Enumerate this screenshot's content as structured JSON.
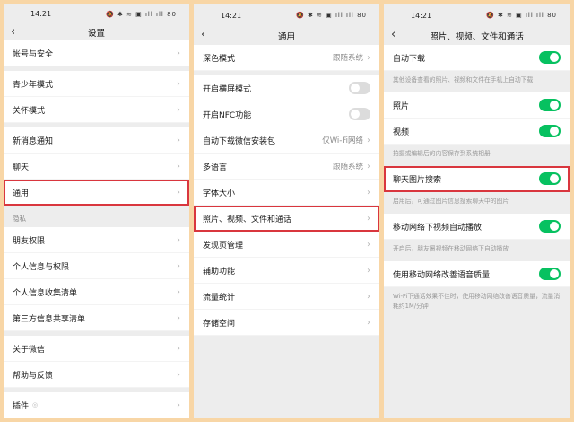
{
  "status_bar": {
    "time": "14:21",
    "icons": "🔕 ✱ ≋ ▣ ıll ıll 80"
  },
  "panels": [
    {
      "title": "设置",
      "items": [
        {
          "type": "row",
          "label": "帐号与安全",
          "chevron": true
        },
        {
          "type": "gap"
        },
        {
          "type": "row",
          "label": "青少年模式",
          "chevron": true
        },
        {
          "type": "row",
          "label": "关怀模式",
          "chevron": true
        },
        {
          "type": "gap"
        },
        {
          "type": "row",
          "label": "新消息通知",
          "chevron": true
        },
        {
          "type": "row",
          "label": "聊天",
          "chevron": true
        },
        {
          "type": "row",
          "label": "通用",
          "chevron": true,
          "highlight": true
        },
        {
          "type": "section",
          "label": "隐私"
        },
        {
          "type": "row",
          "label": "朋友权限",
          "chevron": true
        },
        {
          "type": "row",
          "label": "个人信息与权限",
          "chevron": true
        },
        {
          "type": "row",
          "label": "个人信息收集清单",
          "chevron": true
        },
        {
          "type": "row",
          "label": "第三方信息共享清单",
          "chevron": true
        },
        {
          "type": "gap"
        },
        {
          "type": "row",
          "label": "关于微信",
          "chevron": true
        },
        {
          "type": "row",
          "label": "帮助与反馈",
          "chevron": true
        },
        {
          "type": "gap"
        },
        {
          "type": "row",
          "label": "插件",
          "chevron": true,
          "icon": "plugin-pin-icon"
        }
      ]
    },
    {
      "title": "通用",
      "items": [
        {
          "type": "row",
          "label": "深色模式",
          "value": "跟随系统",
          "chevron": true
        },
        {
          "type": "gap"
        },
        {
          "type": "row",
          "label": "开启横屏模式",
          "toggle": false
        },
        {
          "type": "row",
          "label": "开启NFC功能",
          "toggle": false
        },
        {
          "type": "row",
          "label": "自动下载微信安装包",
          "value": "仅Wi-Fi网络",
          "chevron": true
        },
        {
          "type": "row",
          "label": "多语言",
          "value": "跟随系统",
          "chevron": true
        },
        {
          "type": "row",
          "label": "字体大小",
          "chevron": true
        },
        {
          "type": "row",
          "label": "照片、视频、文件和通话",
          "chevron": true,
          "highlight": true
        },
        {
          "type": "row",
          "label": "发现页管理",
          "chevron": true
        },
        {
          "type": "row",
          "label": "辅助功能",
          "chevron": true
        },
        {
          "type": "row",
          "label": "流量统计",
          "chevron": true
        },
        {
          "type": "row",
          "label": "存储空间",
          "chevron": true
        }
      ]
    },
    {
      "title": "照片、视频、文件和通话",
      "items": [
        {
          "type": "row",
          "label": "自动下载",
          "toggle": true
        },
        {
          "type": "desc",
          "label": "其他设备查看的照片、视频和文件在手机上自动下载"
        },
        {
          "type": "row",
          "label": "照片",
          "toggle": true
        },
        {
          "type": "row",
          "label": "视频",
          "toggle": true
        },
        {
          "type": "desc",
          "label": "拍摄或编辑后的内容保存到系统相册"
        },
        {
          "type": "row",
          "label": "聊天图片搜索",
          "toggle": true,
          "highlight": true
        },
        {
          "type": "desc",
          "label": "启用后，可通过图片信息搜索聊天中的图片"
        },
        {
          "type": "row",
          "label": "移动网络下视频自动播放",
          "toggle": true
        },
        {
          "type": "desc",
          "label": "开启后，朋友圈视频在移动网络下自动播放"
        },
        {
          "type": "row",
          "label": "使用移动网络改善语音质量",
          "toggle": true
        },
        {
          "type": "desc",
          "label": "Wi-Fi下通话效果不佳时，使用移动网络改善语音质量，流量消耗约1M/分钟"
        }
      ]
    }
  ],
  "colors": {
    "accent": "#07c160",
    "highlight": "#d9363e",
    "background": "#f8d6a6"
  }
}
